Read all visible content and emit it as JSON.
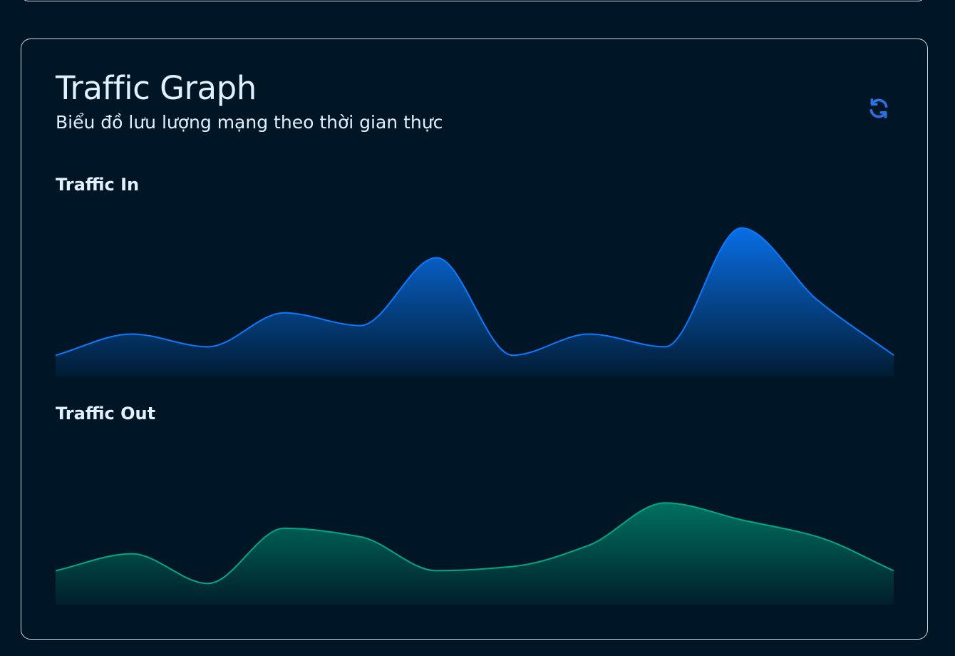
{
  "header": {
    "title": "Traffic Graph",
    "subtitle": "Biểu đồ lưu lượng mạng theo thời gian thực"
  },
  "refresh_button": {
    "icon": "refresh-icon",
    "color": "#2f6fe0"
  },
  "chart_data": [
    {
      "type": "area",
      "title": "Traffic In",
      "x": [
        0,
        1,
        2,
        3,
        4,
        5,
        6,
        7,
        8,
        9,
        10,
        11
      ],
      "values": [
        10,
        20,
        14,
        30,
        24,
        56,
        10,
        20,
        14,
        70,
        36,
        10
      ],
      "ylim": [
        0,
        80
      ],
      "color": "#0a7aff",
      "grid": false,
      "legend": "none"
    },
    {
      "type": "area",
      "title": "Traffic Out",
      "x": [
        0,
        1,
        2,
        3,
        4,
        5,
        6,
        7,
        8,
        9,
        10,
        11
      ],
      "values": [
        16,
        24,
        10,
        36,
        32,
        16,
        18,
        28,
        48,
        40,
        32,
        16
      ],
      "ylim": [
        0,
        80
      ],
      "color": "#00a884",
      "grid": false,
      "legend": "none"
    }
  ]
}
